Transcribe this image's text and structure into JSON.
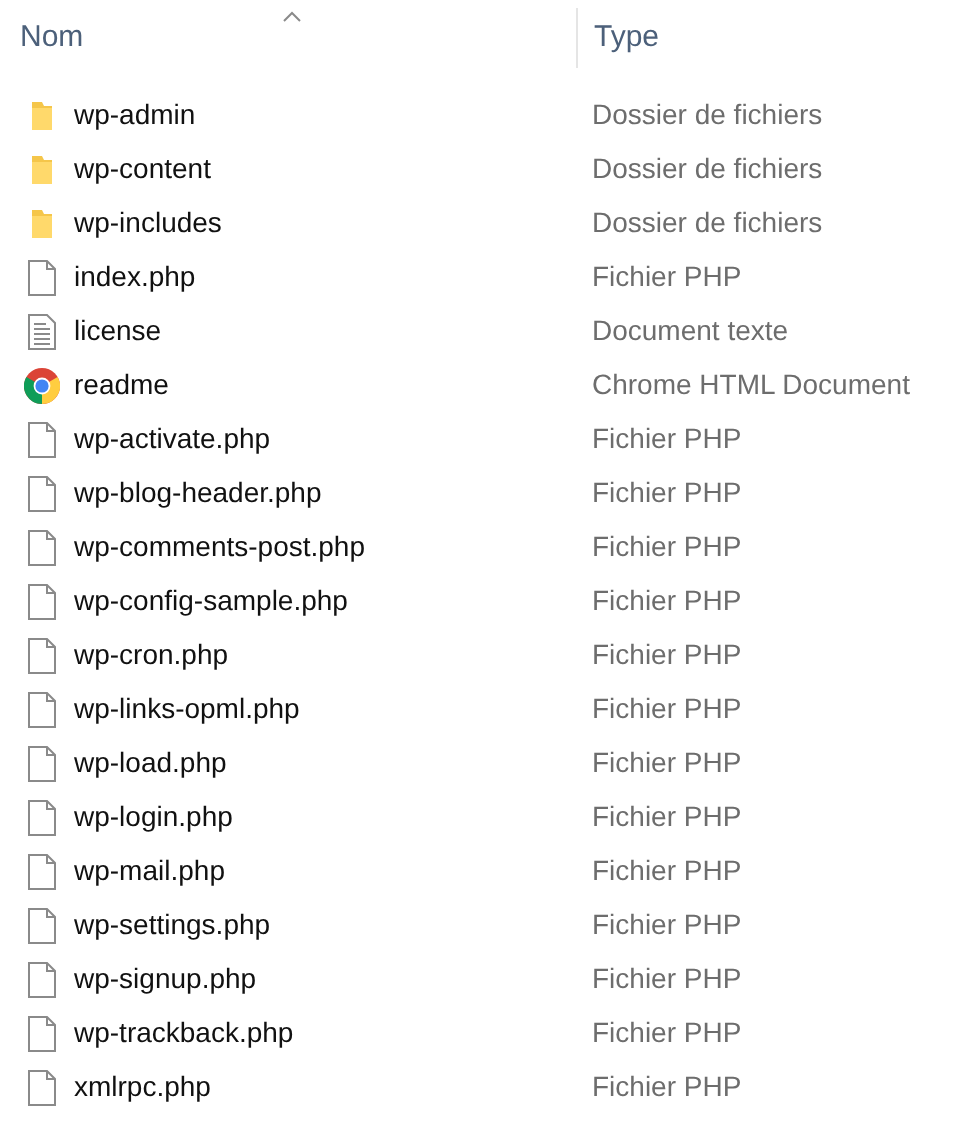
{
  "columns": [
    {
      "label": "Nom",
      "sorted": true
    },
    {
      "label": "Type",
      "sorted": false
    }
  ],
  "rows": [
    {
      "name": "wp-admin",
      "type": "Dossier de fichiers",
      "kind": "folder"
    },
    {
      "name": "wp-content",
      "type": "Dossier de fichiers",
      "kind": "folder"
    },
    {
      "name": "wp-includes",
      "type": "Dossier de fichiers",
      "kind": "folder"
    },
    {
      "name": "index.php",
      "type": "Fichier PHP",
      "kind": "file"
    },
    {
      "name": "license",
      "type": "Document texte",
      "kind": "text"
    },
    {
      "name": "readme",
      "type": "Chrome HTML Document",
      "kind": "chrome"
    },
    {
      "name": "wp-activate.php",
      "type": "Fichier PHP",
      "kind": "file"
    },
    {
      "name": "wp-blog-header.php",
      "type": "Fichier PHP",
      "kind": "file"
    },
    {
      "name": "wp-comments-post.php",
      "type": "Fichier PHP",
      "kind": "file"
    },
    {
      "name": "wp-config-sample.php",
      "type": "Fichier PHP",
      "kind": "file"
    },
    {
      "name": "wp-cron.php",
      "type": "Fichier PHP",
      "kind": "file"
    },
    {
      "name": "wp-links-opml.php",
      "type": "Fichier PHP",
      "kind": "file"
    },
    {
      "name": "wp-load.php",
      "type": "Fichier PHP",
      "kind": "file"
    },
    {
      "name": "wp-login.php",
      "type": "Fichier PHP",
      "kind": "file"
    },
    {
      "name": "wp-mail.php",
      "type": "Fichier PHP",
      "kind": "file"
    },
    {
      "name": "wp-settings.php",
      "type": "Fichier PHP",
      "kind": "file"
    },
    {
      "name": "wp-signup.php",
      "type": "Fichier PHP",
      "kind": "file"
    },
    {
      "name": "wp-trackback.php",
      "type": "Fichier PHP",
      "kind": "file"
    },
    {
      "name": "xmlrpc.php",
      "type": "Fichier PHP",
      "kind": "file"
    }
  ]
}
